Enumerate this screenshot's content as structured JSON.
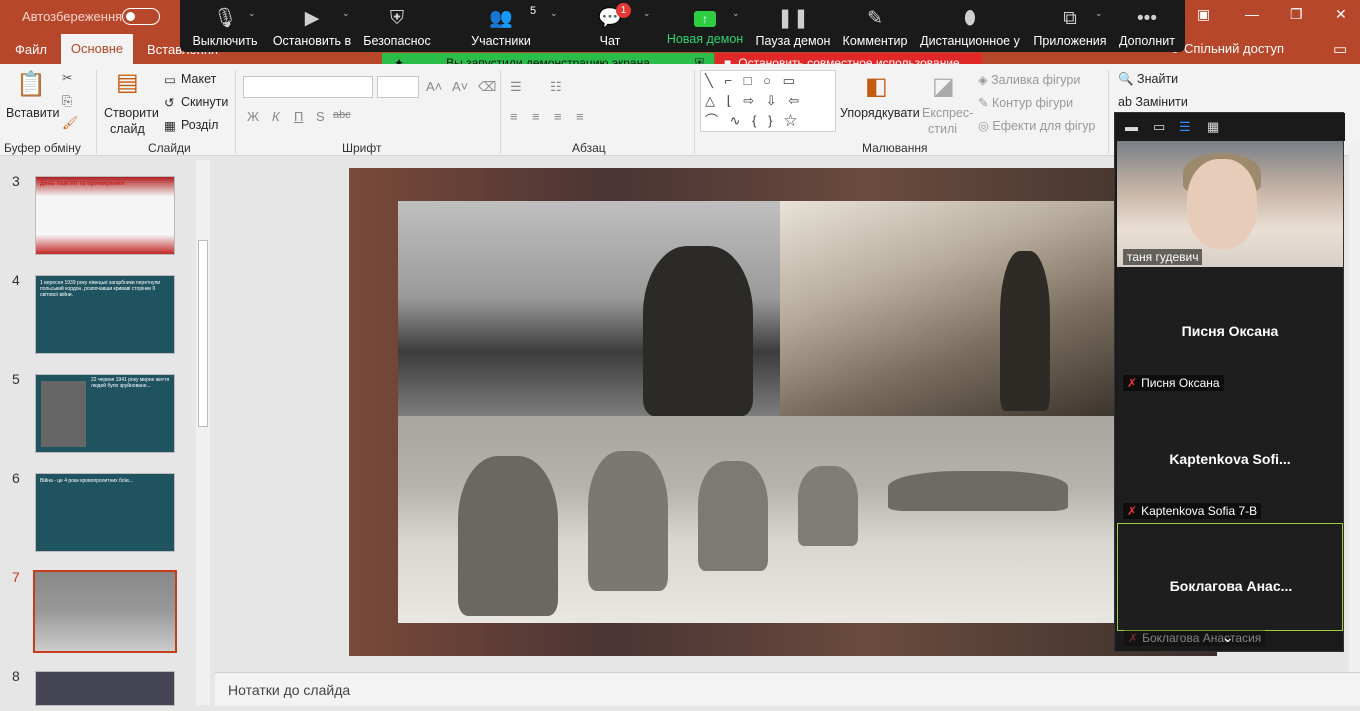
{
  "titlebar": {
    "autosave": "Автозбереження"
  },
  "zoom_toolbar": {
    "items": [
      {
        "label": "Выключить",
        "icon": "microphone-icon"
      },
      {
        "label": "Остановить в",
        "icon": "video-camera-icon"
      },
      {
        "label": "Безопаснос",
        "icon": "shield-icon"
      },
      {
        "label": "Участники",
        "icon": "participants-icon",
        "count": "5"
      },
      {
        "label": "Чат",
        "icon": "chat-icon",
        "badge": "1"
      },
      {
        "label": "Новая демон",
        "icon": "share-screen-icon"
      },
      {
        "label": "Пауза демон",
        "icon": "pause-icon"
      },
      {
        "label": "Комментир",
        "icon": "pen-icon"
      },
      {
        "label": "Дистанционное у",
        "icon": "mouse-icon"
      },
      {
        "label": "Приложения",
        "icon": "apps-icon"
      },
      {
        "label": "Дополнит",
        "icon": "more-icon"
      }
    ]
  },
  "share_banner": {
    "status": "Вы запустили демонстрацию экрана",
    "stop": "Остановить совместное использование"
  },
  "tabs": {
    "file": "Файл",
    "home": "Основне",
    "insert": "Вставлення",
    "share": "Спільний доступ"
  },
  "ribbon": {
    "clipboard": {
      "paste": "Вставити",
      "label": "Буфер обміну"
    },
    "slides": {
      "new_slide": "Створити",
      "new_slide2": "слайд",
      "layout": "Макет",
      "reset": "Скинути",
      "section": "Розділ",
      "label": "Слайди"
    },
    "font": {
      "label": "Шрифт",
      "bold": "Ж",
      "italic": "К",
      "underline": "П",
      "shadow": "S",
      "strike": "abc"
    },
    "paragraph": {
      "label": "Абзац"
    },
    "drawing": {
      "arrange": "Упорядкувати",
      "quick_styles": "Експрес-",
      "quick_styles2": "стилі",
      "fill": "Заливка фігури",
      "outline": "Контур фігури",
      "effects": "Ефекти для фігур",
      "label": "Малювання"
    },
    "editing": {
      "find": "Знайти",
      "replace": "Замінити"
    }
  },
  "slides": [
    {
      "num": "3",
      "title": "День пам'яті та примирення"
    },
    {
      "num": "4",
      "text": "1 вересня 1939 року німецькі загарбники перетнули польський кордон, розпочавши кривавi сторінки II світової війни."
    },
    {
      "num": "5",
      "text": "22 червня 1941 року мирне життя людей було зруйноване..."
    },
    {
      "num": "6",
      "text": "Війна - це 4 роки кровопролитних боїв..."
    },
    {
      "num": "7"
    },
    {
      "num": "8"
    }
  ],
  "notes": {
    "placeholder": "Нотатки до слайда"
  },
  "zoom_panel": {
    "tiles": [
      {
        "label": "таня гудевич"
      },
      {
        "name": "Писня Оксана",
        "label": "Писня Оксана"
      },
      {
        "name": "Kaptenkova  Sofi...",
        "label": "Kaptenkova Sofia 7-B"
      },
      {
        "name": "Боклагова  Анас...",
        "label": "Боклагова Анастасия"
      }
    ]
  },
  "colors": {
    "ppt_accent": "#b7472a",
    "zoom_green": "#2bbd4a",
    "zoom_red": "#e02828"
  }
}
